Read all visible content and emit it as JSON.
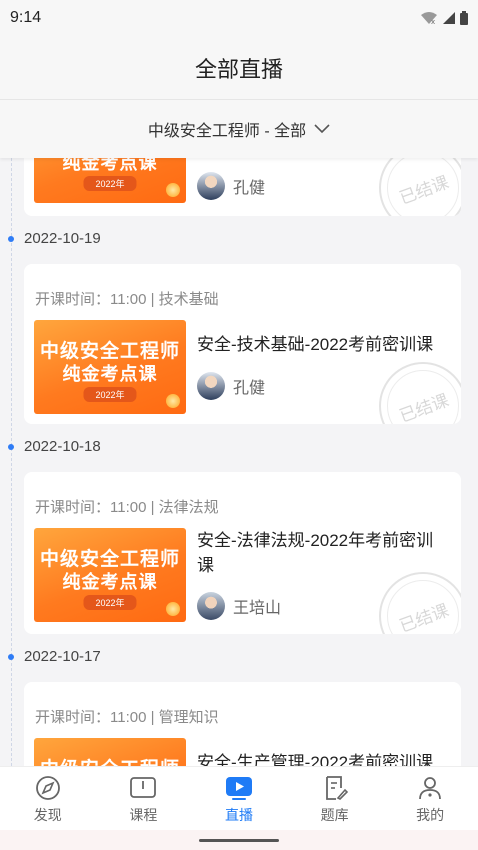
{
  "status_bar": {
    "time": "9:14"
  },
  "header": {
    "title": "全部直播"
  },
  "filter": {
    "label": "中级安全工程师 - 全部"
  },
  "thumbnail": {
    "line1": "中级安全工程师",
    "line2": "纯金考点课",
    "year": "2022年"
  },
  "stamp_text": "已结课",
  "cards": [
    {
      "teacher": "孔健"
    },
    {
      "date": "2022-10-19",
      "time": "开课时间：11:00 | 技术基础",
      "title": "安全-技术基础-2022考前密训课",
      "teacher": "孔健"
    },
    {
      "date": "2022-10-18",
      "time": "开课时间：11:00 | 法律法规",
      "title": "安全-法律法规-2022年考前密训课",
      "teacher": "王培山"
    },
    {
      "date": "2022-10-17",
      "time": "开课时间：11:00 | 管理知识",
      "title": "安全-生产管理-2022考前密训课"
    }
  ],
  "tabs": [
    {
      "label": "发现",
      "icon": "compass-icon"
    },
    {
      "label": "课程",
      "icon": "book-icon"
    },
    {
      "label": "直播",
      "icon": "live-play-icon",
      "active": true
    },
    {
      "label": "题库",
      "icon": "exam-edit-icon"
    },
    {
      "label": "我的",
      "icon": "user-icon"
    }
  ],
  "colors": {
    "accent": "#1f7bf6",
    "thumbnail_orange": "#ff7a1f"
  }
}
